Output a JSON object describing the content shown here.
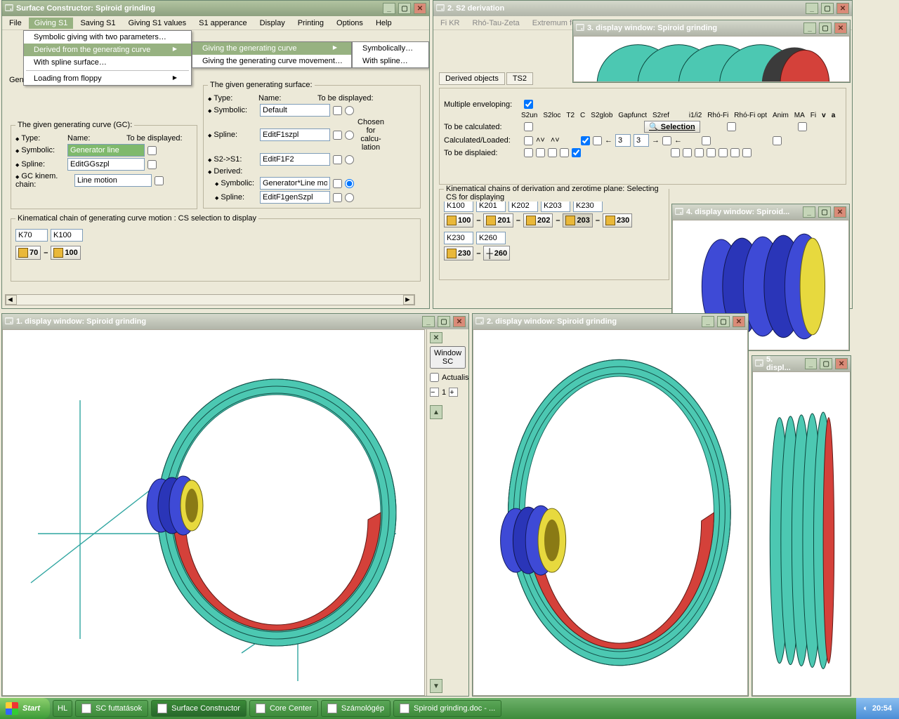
{
  "win_sc": {
    "title": "Surface Constructor: Spiroid grinding"
  },
  "win_s2": {
    "title": "2. S2 derivation"
  },
  "win_d1": {
    "title": "1. display window: Spiroid grinding"
  },
  "win_d2": {
    "title": "2. display window: Spiroid grinding"
  },
  "win_d3": {
    "title": "3. display window: Spiroid grinding"
  },
  "win_d4": {
    "title": "4. display window: Spiroid..."
  },
  "win_d5": {
    "title": "5. displ..."
  },
  "menu": {
    "file": "File",
    "giving_s1": "Giving S1",
    "saving_s1": "Saving S1",
    "giving_s1_values": "Giving S1 values",
    "s1_appearance": "S1 apperance",
    "display": "Display",
    "printing": "Printing",
    "options": "Options",
    "help": "Help"
  },
  "dd1": {
    "symbolic_two": "Symbolic giving with two parameters…",
    "derived": "Derived from the generating curve",
    "with_spline": "With spline surface…",
    "load_floppy": "Loading from floppy"
  },
  "dd2": {
    "gen_curve": "Giving the generating curve",
    "gen_curve_movement": "Giving the generating curve movement…"
  },
  "dd3": {
    "symbolically": "Symbolically…",
    "with_spline": "With spline…"
  },
  "gc": {
    "legend": "The given generating curve (GC):",
    "type": "Type:",
    "name": "Name:",
    "tbd": "To be displayed:",
    "symbolic": "Symbolic:",
    "symbolic_val": "Generator line",
    "spline": "Spline:",
    "spline_val": "EditGGszpl",
    "kinem": "GC kinem. chain:",
    "kinem_val": "Line motion"
  },
  "gs": {
    "legend": "The given generating surface:",
    "type": "Type:",
    "name": "Name:",
    "tbd": "To be displayed:",
    "symbolic": "Symbolic:",
    "symbolic_val": "Default",
    "spline": "Spline:",
    "spline_val": "EditF1szpl",
    "s2s1": "S2->S1:",
    "s2s1_val": "EditF1F2",
    "derived": "Derived:",
    "dsymbolic": "Symbolic:",
    "dsymbolic_val": "Generator*Line moti",
    "dspline": "Spline:",
    "dspline_val": "EditF1genSzpl",
    "chosen": "Chosen for calcu-lation"
  },
  "kinchain": {
    "legend": "Kinematical chain of generating curve motion : CS selection to display",
    "k70": "K70",
    "k100": "K100",
    "b70": "70",
    "b100": "100"
  },
  "s2": {
    "menu_fikr": "Fi KR",
    "menu_rhotau": "Rhó-Tau-Zeta",
    "menu_extremum": "Extremum featur",
    "tab_derived": "Derived objects",
    "tab_ts2": "TS2",
    "mult_env": "Multiple enveloping:",
    "cols": [
      "S2un",
      "S2loc",
      "T2",
      "C",
      "S2glob",
      "Gapfunct",
      "S2ref",
      "i1/i2",
      "Rhó-Fi",
      "Rhó-Fi opt",
      "Anim",
      "MA",
      "Fi",
      "v",
      "a"
    ],
    "rows": {
      "tbc": "To be calculated:",
      "cl": "Calculated/Loaded:",
      "tbd": "To be displaied:"
    },
    "selection": "Selection",
    "num1": "3",
    "num2": "3"
  },
  "kincs": {
    "legend": "Kinematical chains of derivation and zerotime plane: Selecting CS for displaying",
    "k": [
      "K100",
      "K201",
      "K202",
      "K203",
      "K230"
    ],
    "b": [
      "100",
      "201",
      "202",
      "203",
      "230"
    ],
    "k2": [
      "K230",
      "K260"
    ],
    "b2": [
      "230",
      "260"
    ]
  },
  "gen_label": "Gen",
  "disp1_panel": {
    "window_sc": "Window SC",
    "actualise": "Actualise",
    "step": "1"
  },
  "taskbar": {
    "start": "Start",
    "hl": "HL",
    "items": [
      "SC futtatások",
      "Surface Constructor",
      "Core Center",
      "Számológép",
      "Spiroid grinding.doc - ..."
    ],
    "time": "20:54"
  }
}
